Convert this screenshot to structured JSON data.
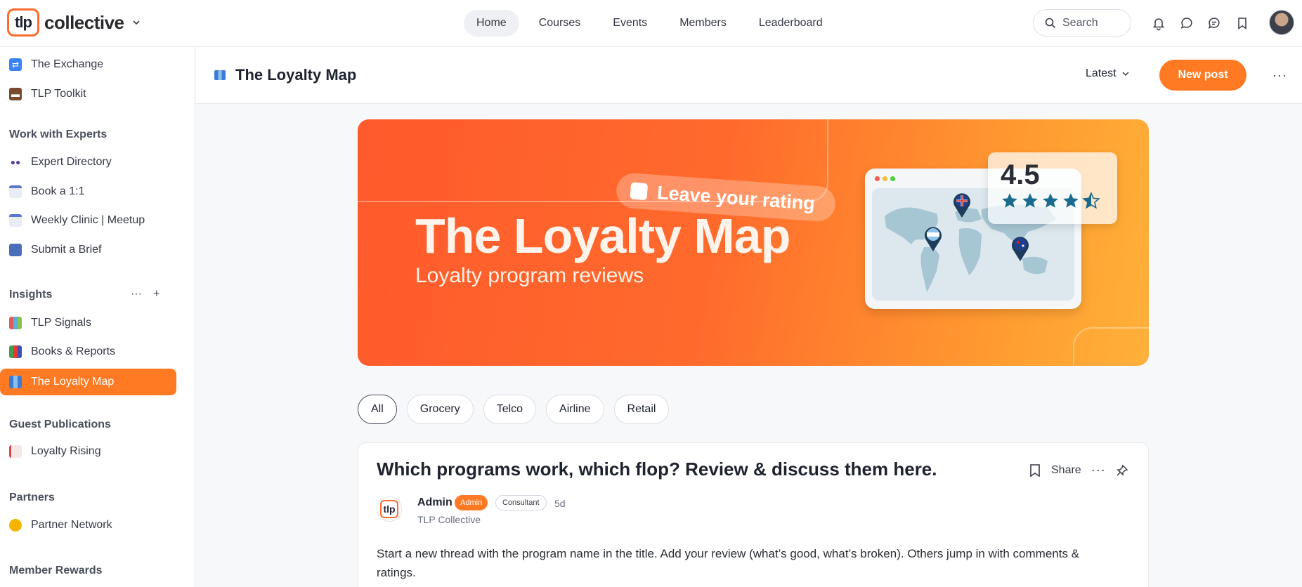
{
  "brand": {
    "logo_mark": "tlp",
    "name": "collective"
  },
  "nav": {
    "items": [
      {
        "label": "Home",
        "active": true
      },
      {
        "label": "Courses",
        "active": false
      },
      {
        "label": "Events",
        "active": false
      },
      {
        "label": "Members",
        "active": false
      },
      {
        "label": "Leaderboard",
        "active": false
      }
    ]
  },
  "search": {
    "label": "Search"
  },
  "top_icons": [
    "bell-icon",
    "chat-icon",
    "messages-icon",
    "bookmark-icon"
  ],
  "sidebar": {
    "items_top": [
      {
        "label": "The Exchange",
        "icon": "exchange-icon"
      },
      {
        "label": "TLP Toolkit",
        "icon": "briefcase-icon"
      }
    ],
    "sections": [
      {
        "title": "Work with Experts",
        "items": [
          {
            "label": "Expert Directory",
            "icon": "people-icon"
          },
          {
            "label": "Book a 1:1",
            "icon": "calendar-icon"
          },
          {
            "label": "Weekly Clinic | Meetup",
            "icon": "calendar-icon"
          },
          {
            "label": "Submit a Brief",
            "icon": "mailbox-icon"
          }
        ]
      },
      {
        "title": "Insights",
        "items": [
          {
            "label": "TLP Signals",
            "icon": "chart-icon"
          },
          {
            "label": "Books & Reports",
            "icon": "books-icon"
          },
          {
            "label": "The Loyalty Map",
            "icon": "map-icon",
            "active": true
          }
        ]
      },
      {
        "title": "Guest Publications",
        "items": [
          {
            "label": "Loyalty Rising",
            "icon": "memo-icon"
          }
        ]
      },
      {
        "title": "Partners",
        "items": [
          {
            "label": "Partner Network",
            "icon": "handshake-icon"
          }
        ]
      },
      {
        "title": "Member Rewards",
        "items": []
      }
    ]
  },
  "main_header": {
    "title": "The Loyalty Map",
    "sort_label": "Latest",
    "new_post_label": "New post",
    "more_label": "···"
  },
  "banner": {
    "title": "The Loyalty Map",
    "subtitle": "Loyalty program reviews",
    "pill_text": "Leave your rating",
    "rating": "4.5",
    "stars": 4.5,
    "colors": {
      "start": "#ff5a2c",
      "end": "#ffb13a",
      "star": "#1a6b8f"
    }
  },
  "filters": [
    {
      "label": "All",
      "active": true
    },
    {
      "label": "Grocery",
      "active": false
    },
    {
      "label": "Telco",
      "active": false
    },
    {
      "label": "Airline",
      "active": false
    },
    {
      "label": "Retail",
      "active": false
    }
  ],
  "post": {
    "title": "Which programs work, which flop? Review & discuss them here.",
    "share_label": "Share",
    "author": {
      "avatar_text": "tlp",
      "name": "Admin",
      "badge_admin": "Admin",
      "badge_role": "Consultant",
      "time": "5d",
      "org": "TLP Collective"
    },
    "body": "Start a new thread with the program name in the title. Add your review (what’s good, what’s broken). Others jump in with comments & ratings."
  },
  "colors": {
    "accent": "#ff7a22",
    "text": "#1f2330",
    "border": "#e6e8ec"
  }
}
